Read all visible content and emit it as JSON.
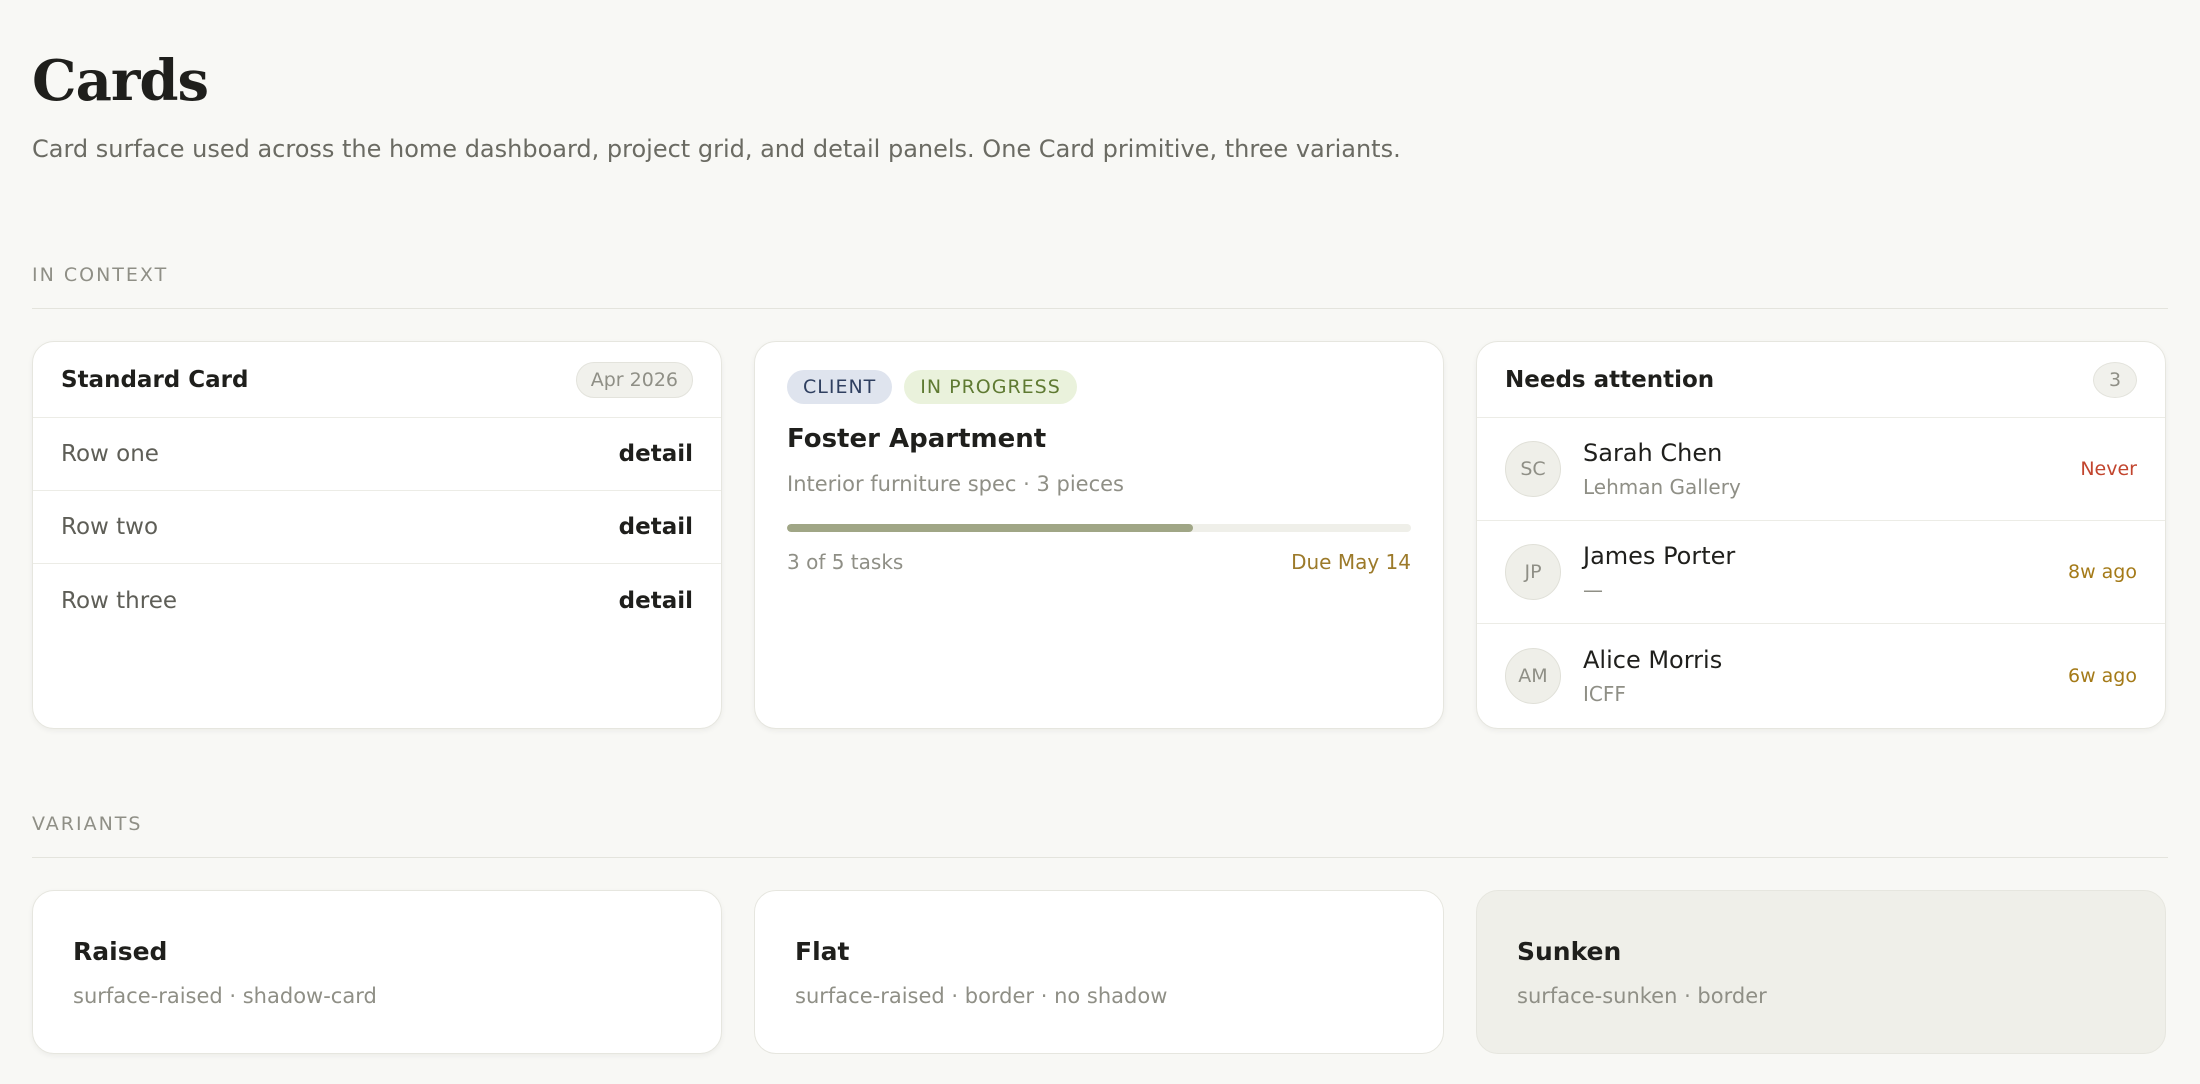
{
  "page": {
    "title": "Cards",
    "subtitle": "Card surface used across the home dashboard, project grid, and detail panels. One Card primitive, three variants."
  },
  "sections": {
    "context": "IN CONTEXT",
    "variants": "VARIANTS"
  },
  "standard_card": {
    "title": "Standard Card",
    "badge": "Apr 2026",
    "rows": [
      {
        "label": "Row one",
        "detail": "detail"
      },
      {
        "label": "Row two",
        "detail": "detail"
      },
      {
        "label": "Row three",
        "detail": "detail"
      }
    ]
  },
  "project_card": {
    "tags": [
      "CLIENT",
      "IN PROGRESS"
    ],
    "title": "Foster Apartment",
    "subtitle": "Interior furniture spec · 3 pieces",
    "progress_fraction": 0.65,
    "tasks": "3 of 5 tasks",
    "due": "Due May 14",
    "colors": {
      "progress": "#a0a686",
      "due": "#9c7a2a"
    }
  },
  "attention_card": {
    "title": "Needs attention",
    "count": "3",
    "people": [
      {
        "initials": "SC",
        "name": "Sarah Chen",
        "org": "Lehman Gallery",
        "time": "Never"
      },
      {
        "initials": "JP",
        "name": "James Porter",
        "org": "—",
        "time": "8w ago"
      },
      {
        "initials": "AM",
        "name": "Alice Morris",
        "org": "ICFF",
        "time": "6w ago"
      }
    ],
    "colors": {
      "never": "#c2452e",
      "ago": "#a47a18"
    }
  },
  "variants": [
    {
      "title": "Raised",
      "desc": "surface-raised · shadow-card"
    },
    {
      "title": "Flat",
      "desc": "surface-raised · border · no shadow"
    },
    {
      "title": "Sunken",
      "desc": "surface-sunken · border"
    }
  ]
}
